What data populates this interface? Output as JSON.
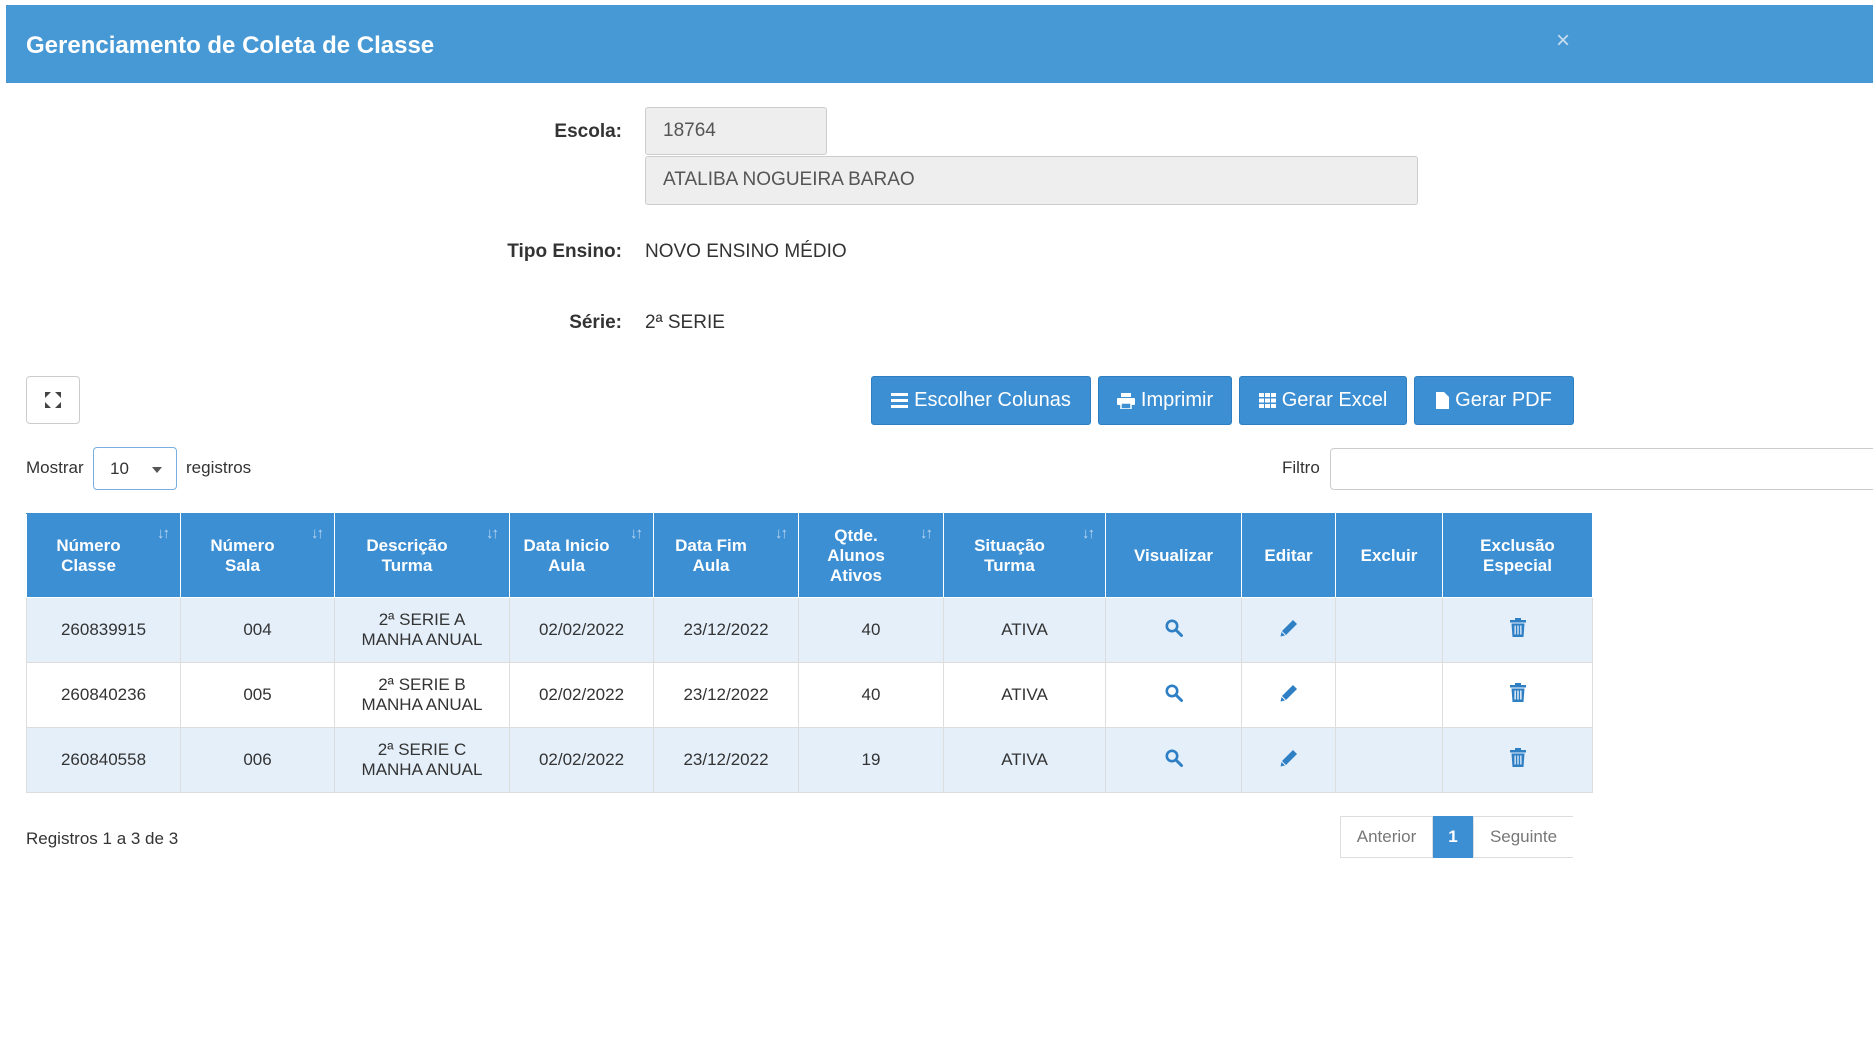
{
  "modal": {
    "title": "Gerenciamento de Coleta de Classe",
    "close_label": "×"
  },
  "form": {
    "escola_label": "Escola:",
    "escola_codigo": "18764",
    "escola_nome": "ATALIBA NOGUEIRA BARAO",
    "tipo_ensino_label": "Tipo Ensino:",
    "tipo_ensino_value": "NOVO ENSINO MÉDIO",
    "serie_label": "Série:",
    "serie_value": "2ª SERIE"
  },
  "toolbar": {
    "escolher_colunas": "Escolher Colunas",
    "imprimir": "Imprimir",
    "gerar_excel": "Gerar Excel",
    "gerar_pdf": "Gerar PDF"
  },
  "length": {
    "mostrar": "Mostrar",
    "value": "10",
    "registros": "registros"
  },
  "filter": {
    "label": "Filtro",
    "value": ""
  },
  "table": {
    "headers": [
      {
        "line1": "Número",
        "line2": "Classe",
        "line3": ""
      },
      {
        "line1": "Número",
        "line2": "Sala",
        "line3": ""
      },
      {
        "line1": "Descrição",
        "line2": "Turma",
        "line3": ""
      },
      {
        "line1": "Data Inicio",
        "line2": "Aula",
        "line3": ""
      },
      {
        "line1": "Data Fim",
        "line2": "Aula",
        "line3": ""
      },
      {
        "line1": "Qtde.",
        "line2": "Alunos",
        "line3": "Ativos"
      },
      {
        "line1": "Situação",
        "line2": "Turma",
        "line3": ""
      },
      {
        "line1": "Visualizar",
        "line2": "",
        "line3": ""
      },
      {
        "line1": "Editar",
        "line2": "",
        "line3": ""
      },
      {
        "line1": "Excluir",
        "line2": "",
        "line3": ""
      },
      {
        "line1": "Exclusão",
        "line2": "Especial",
        "line3": ""
      }
    ],
    "rows": [
      {
        "numero_classe": "260839915",
        "numero_sala": "004",
        "descricao_l1": "2ª SERIE A",
        "descricao_l2": "MANHA ANUAL",
        "data_inicio": "02/02/2022",
        "data_fim": "23/12/2022",
        "qtde": "40",
        "situacao": "ATIVA"
      },
      {
        "numero_classe": "260840236",
        "numero_sala": "005",
        "descricao_l1": "2ª SERIE B",
        "descricao_l2": "MANHA ANUAL",
        "data_inicio": "02/02/2022",
        "data_fim": "23/12/2022",
        "qtde": "40",
        "situacao": "ATIVA"
      },
      {
        "numero_classe": "260840558",
        "numero_sala": "006",
        "descricao_l1": "2ª SERIE C",
        "descricao_l2": "MANHA ANUAL",
        "data_inicio": "02/02/2022",
        "data_fim": "23/12/2022",
        "qtde": "19",
        "situacao": "ATIVA"
      }
    ]
  },
  "info": {
    "text": "Registros 1 a 3 de 3"
  },
  "pagination": {
    "anterior": "Anterior",
    "current": "1",
    "seguinte": "Seguinte"
  },
  "icons": {
    "expand": "expand-icon",
    "list": "list-icon",
    "print": "print-icon",
    "grid": "grid-icon",
    "file": "file-icon",
    "sort": "sort-icon",
    "view": "search-icon",
    "edit": "pencil-icon",
    "delete": "trash-icon"
  },
  "colors": {
    "header_bg": "#4799d5",
    "button_bg": "#3d8fd3",
    "row_stripe": "#e4effa",
    "icon": "#2f7fc4"
  }
}
